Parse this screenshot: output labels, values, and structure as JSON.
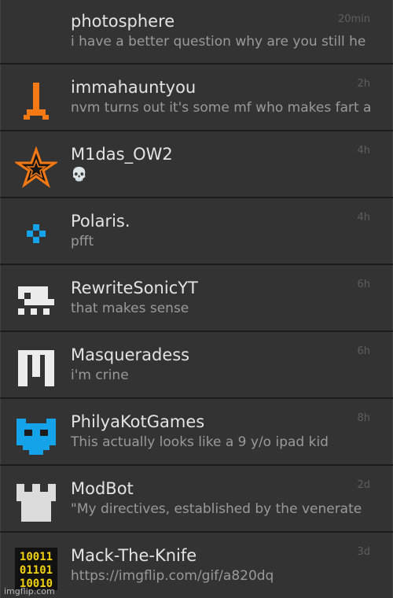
{
  "conversations": [
    {
      "name": "photosphere",
      "preview": "i have a better question why are you still he",
      "time": "20min",
      "avatar_icon": "none"
    },
    {
      "name": "immahauntyou",
      "preview": "nvm turns out it's some mf who makes fart a",
      "time": "2h",
      "avatar_icon": "orange-figure-icon"
    },
    {
      "name": "M1das_OW2",
      "preview": "💀",
      "time": "4h",
      "avatar_icon": "orange-star-icon"
    },
    {
      "name": "Polaris.",
      "preview": "pfft",
      "time": "4h",
      "avatar_icon": "blue-diamond-icon"
    },
    {
      "name": "RewriteSonicYT",
      "preview": "that makes sense",
      "time": "6h",
      "avatar_icon": "white-pixel-creature-icon"
    },
    {
      "name": "Masqueradess",
      "preview": "i'm crine",
      "time": "6h",
      "avatar_icon": "white-pixel-mask-icon"
    },
    {
      "name": "PhilyaKotGames",
      "preview": "This actually looks like a 9 y/o ipad kid",
      "time": "8h",
      "avatar_icon": "blue-cat-icon"
    },
    {
      "name": "ModBot",
      "preview": "\"My directives, established by the venerate",
      "time": "2d",
      "avatar_icon": "white-castle-icon"
    },
    {
      "name": "Mack-The-Knife",
      "preview": "https://imgflip.com/gif/a820dq",
      "time": "3d",
      "avatar_icon": "binary-digits-icon"
    }
  ],
  "watermark": "imgflip.com",
  "colors": {
    "background": "#333333",
    "name": "#e3e3e3",
    "preview": "#9a9a9a",
    "time": "#5e5e5e",
    "orange": "#f57a14",
    "blue": "#14a3e8"
  }
}
